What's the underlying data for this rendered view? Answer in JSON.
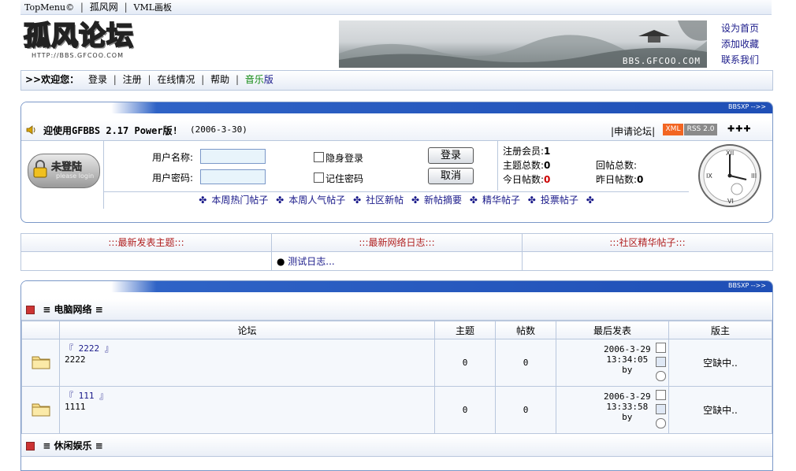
{
  "topmenu": {
    "items": [
      "TopMenu©",
      "孤风网",
      "VML画板"
    ]
  },
  "header": {
    "logo_text": "孤风论坛",
    "logo_url": "HTTP://BBS.GFCOO.COM",
    "banner_text": "BBS.GFCOO.COM",
    "right_links": [
      "设为首页",
      "添加收藏",
      "联系我们"
    ]
  },
  "welcome": {
    "label": ">>欢迎您：",
    "links": [
      "登录",
      "注册",
      "在线情况",
      "帮助"
    ],
    "music": "音乐",
    "music_suffix": "版"
  },
  "banner_tag": "BBSXP -->>",
  "news": {
    "title": "迎使用GFBBS 2.17 Power版!",
    "date": "(2006-3-30)",
    "apply": "申请论坛",
    "xml_badge": "XML",
    "rss_badge": "RSS 2.0",
    "arrows": "✚✚✚"
  },
  "login": {
    "avatar_title": "未登陆",
    "avatar_sub": "please login",
    "username_label": "用户名称:",
    "password_label": "用户密码:",
    "hidden_login": "隐身登录",
    "remember": "记住密码",
    "login_button": "登录",
    "cancel_button": "取消"
  },
  "stats": {
    "members_label": "注册会员:",
    "members_value": "1",
    "topics_label": "主题总数:",
    "topics_value": "0",
    "replies_label": "回帖总数:",
    "replies_value": "",
    "today_label": "今日帖数:",
    "today_value": "0",
    "yesterday_label": "昨日帖数:",
    "yesterday_value": "0"
  },
  "hotlinks": [
    "本周热门帖子",
    "本周人气帖子",
    "社区新帖",
    "新帖摘要",
    "精华帖子",
    "投票帖子"
  ],
  "triple": {
    "headers": [
      ":::最新发表主题:::",
      ":::最新网络日志:::",
      ":::社区精华帖子:::"
    ],
    "blog_item": "测试日志..."
  },
  "category1": {
    "name": "电脑网络",
    "columns": [
      "论坛",
      "主题",
      "帖数",
      "最后发表",
      "版主"
    ],
    "rows": [
      {
        "name": "『 2222 』",
        "desc": "2222",
        "topics": "0",
        "posts": "0",
        "date": "2006-3-29",
        "time": "13:34:05",
        "by": "by",
        "moderator": "空缺中.."
      },
      {
        "name": "『 111 』",
        "desc": "1111",
        "topics": "0",
        "posts": "0",
        "date": "2006-3-29",
        "time": "13:33:58",
        "by": "by",
        "moderator": "空缺中.."
      }
    ]
  },
  "category2": {
    "name": "休闲娱乐"
  }
}
